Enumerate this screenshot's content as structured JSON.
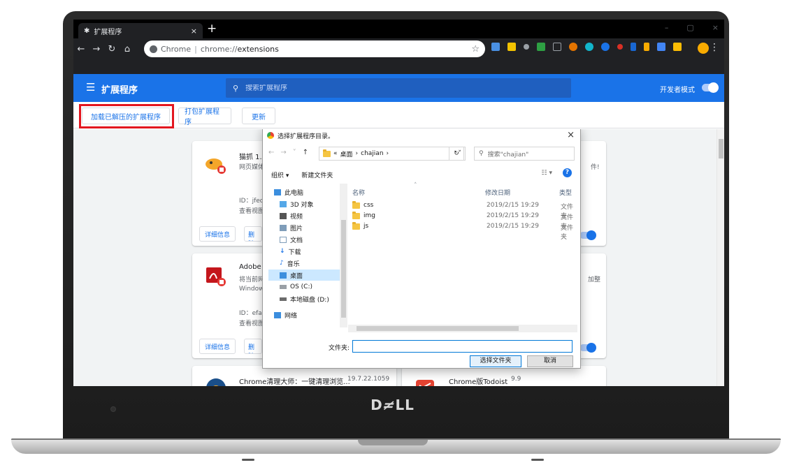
{
  "browser": {
    "tab_title": "扩展程序",
    "tab_close": "×",
    "new_tab": "+",
    "omnibox_secure_label": "Chrome",
    "omnibox_sep": "|",
    "omnibox_url_prefix": "chrome://",
    "omnibox_url_path": "extensions",
    "window_controls": [
      "–",
      "▢",
      "×"
    ]
  },
  "header": {
    "title": "扩展程序",
    "search_placeholder": "搜索扩展程序",
    "dev_mode_label": "开发者模式",
    "dev_mode_on": true,
    "color": "#1a73e8"
  },
  "actions": {
    "load_unpacked": "加载已解压的扩展程序",
    "pack": "打包扩展程序",
    "update": "更新",
    "highlight_color": "#e3161f"
  },
  "cards": [
    {
      "name": "猫抓 1.",
      "desc": "网页媒体",
      "id": "ID：jfed",
      "view": "查看视图",
      "details": "详细信息",
      "remove": "删除",
      "enabled": true
    },
    {
      "name": "Adobe A",
      "desc": "将当前网",
      "desc2": "Window",
      "id": "ID：efai",
      "view": "查看视图",
      "details": "详细信息",
      "remove": "删除",
      "enabled": true
    },
    {
      "name": "Chrome清理大师：一键清理浏览...",
      "version": "19.7.22.1059"
    }
  ],
  "right_cards": {
    "frag1": "件!",
    "frag2": "加整",
    "card3_name": "Chrome版Todoist",
    "card3_version": "9.9"
  },
  "dialog": {
    "title": "选择扩展程序目录。",
    "close": "×",
    "path_root": "«",
    "path_parts": [
      "桌面",
      "chajian"
    ],
    "search_placeholder": "搜索\"chajian\"",
    "organize": "组织 ▾",
    "new_folder": "新建文件夹",
    "help": "?",
    "tree": [
      {
        "label": "此电脑"
      },
      {
        "label": "3D 对象"
      },
      {
        "label": "视频"
      },
      {
        "label": "图片"
      },
      {
        "label": "文档"
      },
      {
        "label": "下载"
      },
      {
        "label": "音乐"
      },
      {
        "label": "桌面",
        "selected": true
      },
      {
        "label": "OS (C:)"
      },
      {
        "label": "本地磁盘 (D:)"
      },
      {
        "label": "网络"
      }
    ],
    "columns": {
      "name": "名称",
      "date": "修改日期",
      "type": "类型"
    },
    "files": [
      {
        "name": "css",
        "date": "2019/2/15 19:29",
        "type": "文件夹"
      },
      {
        "name": "img",
        "date": "2019/2/15 19:29",
        "type": "文件夹"
      },
      {
        "name": "js",
        "date": "2019/2/15 19:29",
        "type": "文件夹"
      }
    ],
    "field_label": "文件夹:",
    "field_value": "",
    "select_button": "选择文件夹",
    "cancel_button": "取消"
  },
  "laptop": {
    "brand": "DØLL"
  }
}
